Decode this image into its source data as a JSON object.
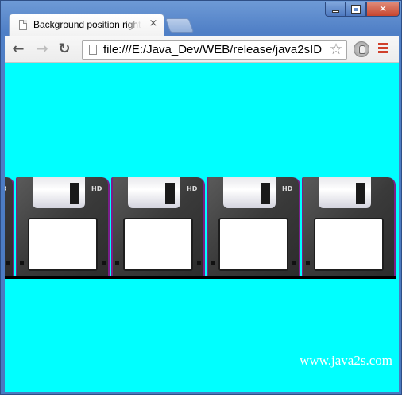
{
  "window": {
    "active_tab_title": "Background position right",
    "tab_close_glyph": "×",
    "controls": {
      "close_glyph": "✕"
    }
  },
  "toolbar": {
    "address_url": "file:///E:/Java_Dev/WEB/release/java2sID",
    "back_glyph": "←",
    "forward_glyph": "→",
    "reload_glyph": "↻",
    "star_glyph": "☆"
  },
  "page": {
    "background_color": "#00ffff",
    "disk_labels": [
      "HD",
      "HD",
      "HD",
      "HD"
    ],
    "watermark": "www.java2s.com"
  }
}
